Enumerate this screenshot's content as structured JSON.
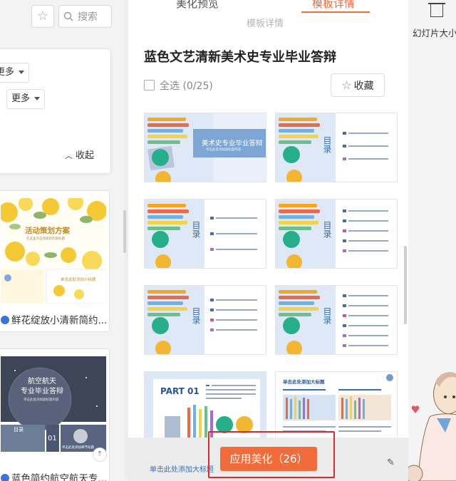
{
  "left_panel": {
    "search_placeholder": "搜索",
    "filter_more_1": "更多",
    "filter_more_2": "更多",
    "collapse_label": "收起",
    "templates": [
      {
        "caption": "鲜花绽放小清新简约...",
        "thumb_title": "活动策划方案",
        "thumb_subtitle": "在这里点击添加您的副标题",
        "thumb_section": "单击此处添加小标题"
      },
      {
        "caption": "蓝色简约航空航天专...",
        "thumb_title_1": "航空航天",
        "thumb_title_2": "专业毕业答辩",
        "thumb_subtitle": "单击此处添加副标题内容",
        "thumb_toc": "目录",
        "thumb_num": "01",
        "thumb_section": "单击此处添加章节标题"
      }
    ]
  },
  "center_panel": {
    "tabs": [
      "美化预览",
      "模板详情"
    ],
    "active_tab": "模板详情",
    "section_label": "模板详情",
    "template_title": "蓝色文艺清新美术史专业毕业答辩",
    "select_all": "全选 (0/25)",
    "favorite": "收藏",
    "apply_button": "应用美化（26）",
    "slides": [
      {
        "type": "cover",
        "title": "美术史专业毕业答辩",
        "subtitle": "单击此处添加副标题内容"
      },
      {
        "type": "toc",
        "title": "目录"
      },
      {
        "type": "toc",
        "title": "目录"
      },
      {
        "type": "toc",
        "title": "目录"
      },
      {
        "type": "toc",
        "title": "目录"
      },
      {
        "type": "toc",
        "title": "目录"
      },
      {
        "type": "part",
        "title": "PART 01"
      },
      {
        "type": "content",
        "title": "单击此处添加大标题"
      }
    ],
    "partial_slide_title": "单击此处添加大标题"
  },
  "right_panel": {
    "slide_size": "幻灯片大小"
  },
  "colors": {
    "accent": "#f26b3a",
    "highlight_border": "#e0292c",
    "slide_blue": "#3b6fb5"
  }
}
